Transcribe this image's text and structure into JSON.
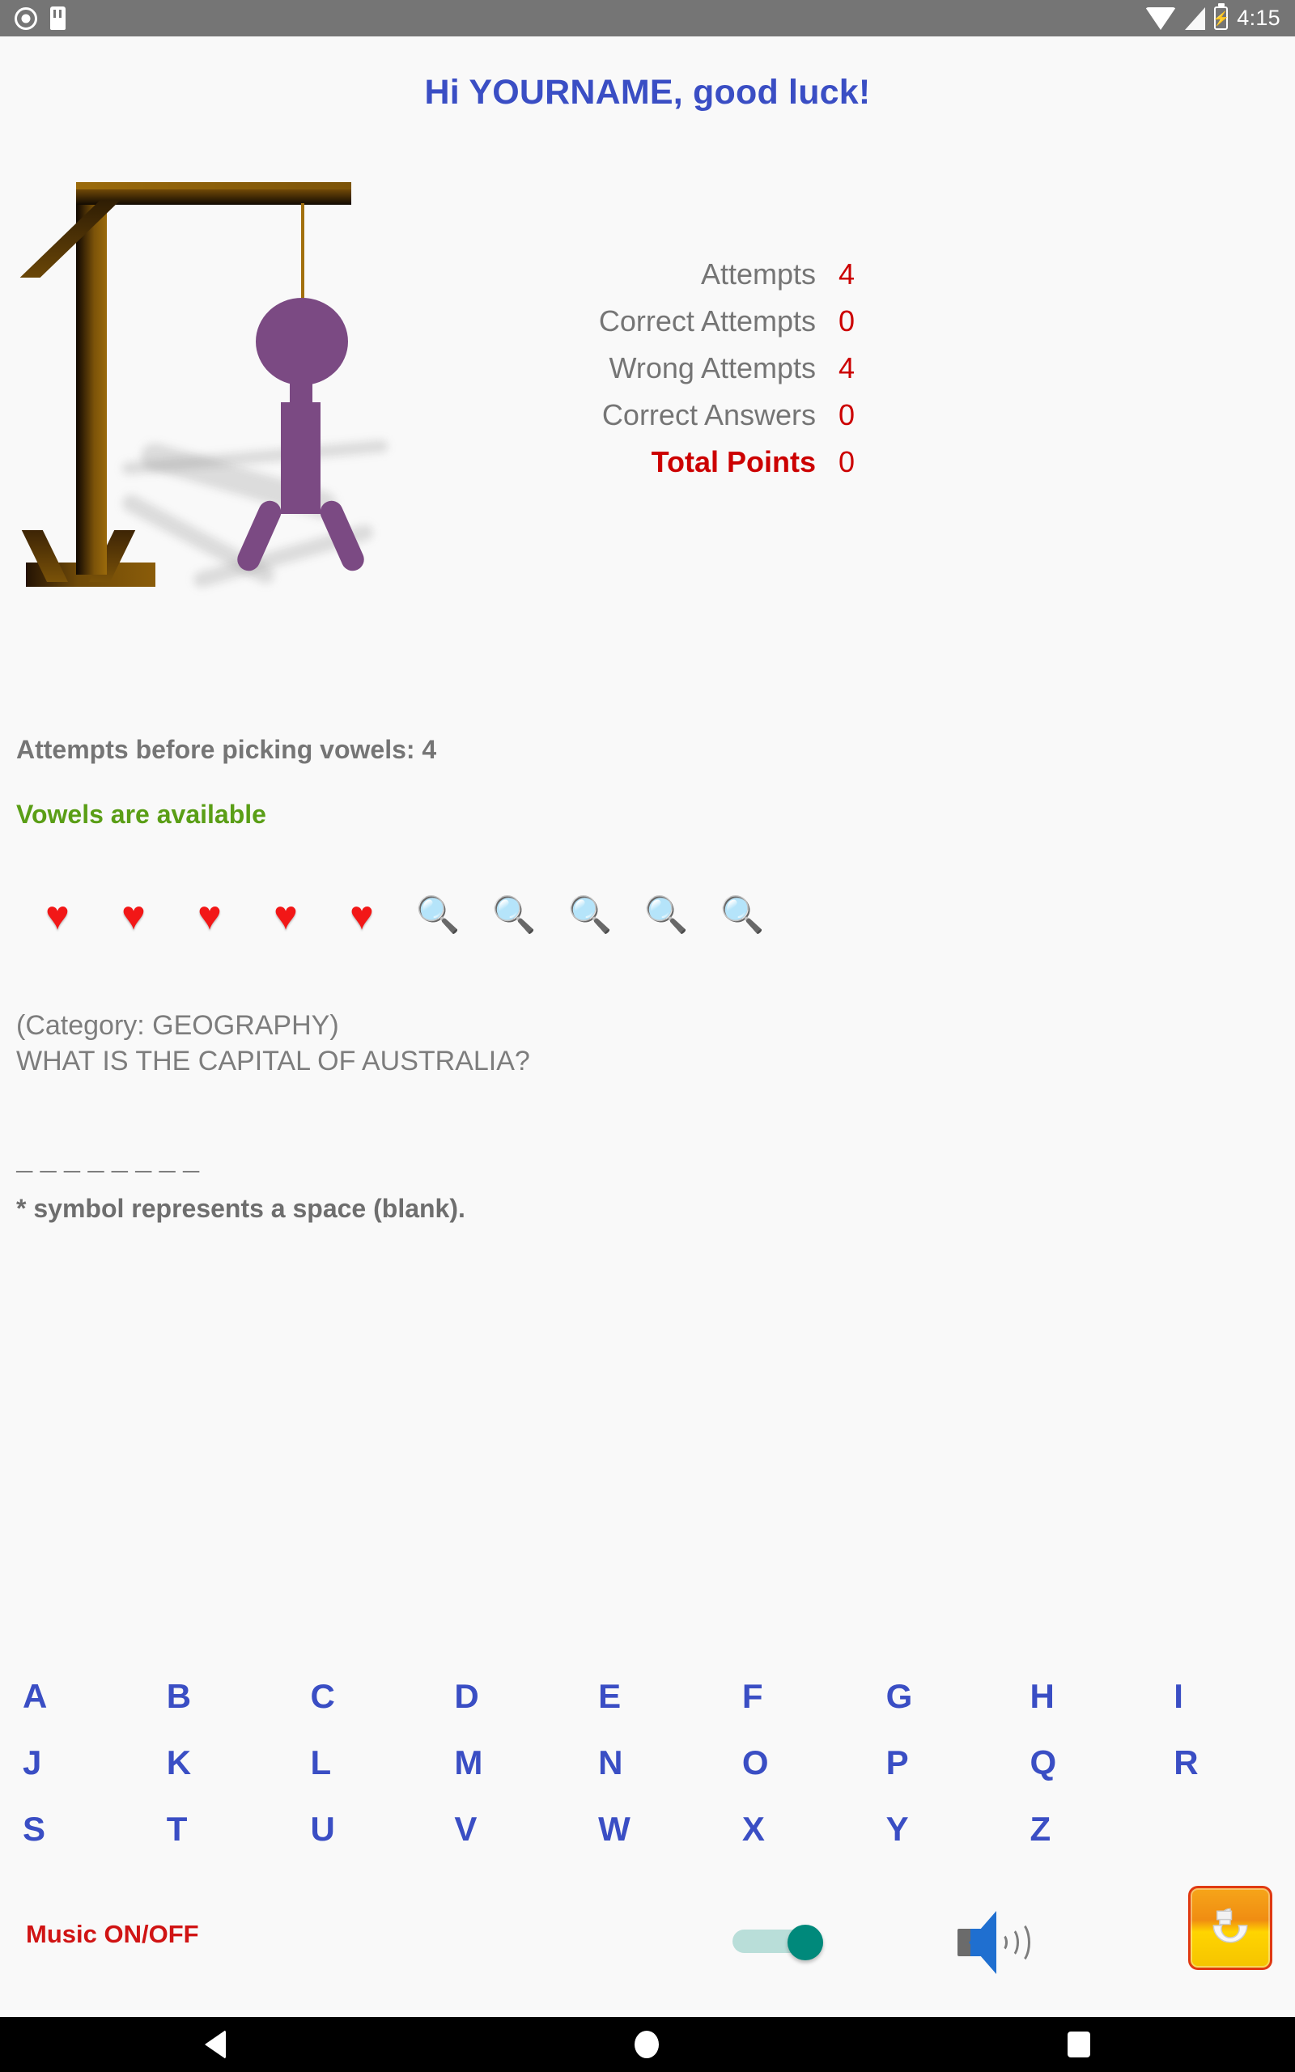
{
  "status_bar": {
    "time": "4:15",
    "icons": [
      "record-icon",
      "sd-card-icon",
      "wifi-icon",
      "cell-signal-icon",
      "battery-charging-icon"
    ],
    "battery_glyph": "⚡"
  },
  "header": {
    "title": "Hi YOURNAME, good luck!",
    "title_color": "#3a4ec4"
  },
  "illustration": {
    "name": "hangman-gallows",
    "figure_color": "#7b4a83",
    "wood_color": "#7d5409",
    "parts_drawn": [
      "head",
      "neck",
      "body",
      "left-leg",
      "right-leg"
    ]
  },
  "stats": {
    "rows": [
      {
        "label": "Attempts",
        "value": "4"
      },
      {
        "label": "Correct Attempts",
        "value": "0"
      },
      {
        "label": "Wrong Attempts",
        "value": "4"
      },
      {
        "label": "Correct Answers",
        "value": "0"
      },
      {
        "label": "Total Points",
        "value": "0"
      }
    ],
    "value_color": "#cc0000",
    "label_color": "#757575"
  },
  "info": {
    "attempts_before_vowels": "Attempts before picking vowels: 4",
    "vowels_status": "Vowels are available",
    "vowels_status_color": "#5a9e16"
  },
  "lives": {
    "icons": [
      "heart-icon",
      "heart-icon",
      "heart-icon",
      "heart-icon",
      "heart-icon",
      "magnifier-icon",
      "magnifier-icon",
      "magnifier-icon",
      "magnifier-icon",
      "magnifier-icon"
    ],
    "heart_glyph": "♥",
    "magnifier_glyph": "🔍",
    "hearts_count": 5,
    "magnifiers_count": 5
  },
  "question": {
    "category_line": "(Category: GEOGRAPHY)",
    "text": "WHAT IS THE CAPITAL OF AUSTRALIA?",
    "blanks": "________",
    "blanks_count": 8,
    "note": "* symbol represents a space (blank)."
  },
  "alphabet": {
    "letters": [
      "A",
      "B",
      "C",
      "D",
      "E",
      "F",
      "G",
      "H",
      "I",
      "J",
      "K",
      "L",
      "M",
      "N",
      "O",
      "P",
      "Q",
      "R",
      "S",
      "T",
      "U",
      "V",
      "W",
      "X",
      "Y",
      "Z",
      "",
      ""
    ],
    "color": "#3a4ec4"
  },
  "controls": {
    "music_label": "Music ON/OFF",
    "music_label_color": "#d01414",
    "music_toggle_on": true,
    "speaker_icon": "speaker-volume-icon",
    "refresh_icon": "restart-refresh-icon"
  },
  "nav_bar": {
    "back": "back-icon",
    "home": "home-icon",
    "recent": "recent-apps-icon"
  }
}
